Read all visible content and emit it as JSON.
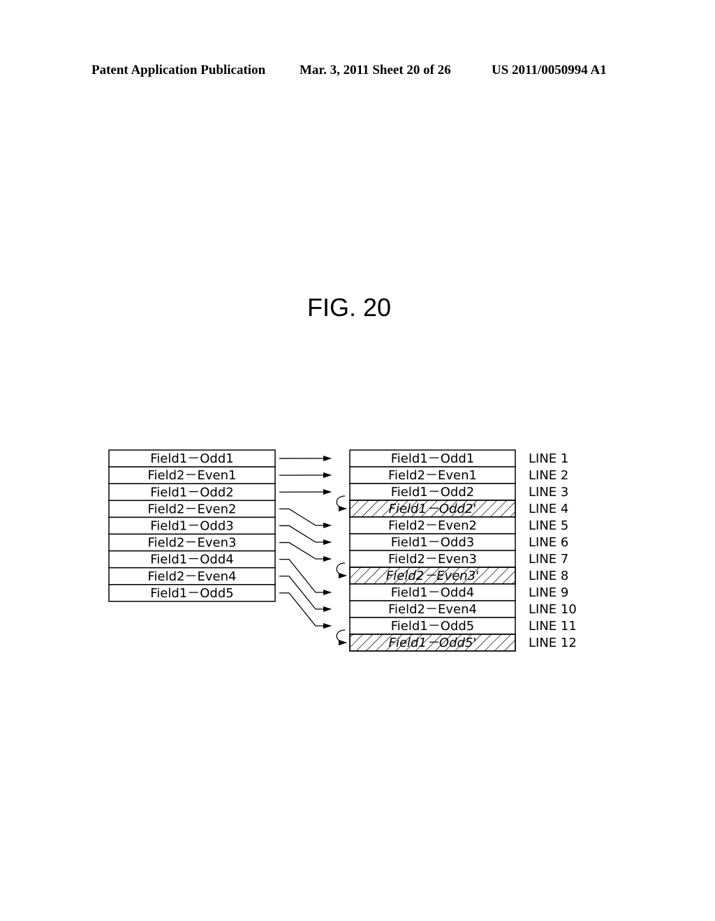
{
  "header": {
    "publication": "Patent Application Publication",
    "date_sheet": "Mar. 3, 2011   Sheet 20 of 26",
    "patent_number": "US 2011/0050994 A1"
  },
  "figure": {
    "title": "FIG. 20",
    "source_fields": [
      "Field1－Odd1",
      "Field2－Even1",
      "Field1－Odd2",
      "Field2－Even2",
      "Field1－Odd3",
      "Field2－Even3",
      "Field1－Odd4",
      "Field2－Even4",
      "Field1－Odd5"
    ],
    "output_lines": [
      {
        "text": "Field1－Odd1",
        "line": "LINE  1",
        "hatched": false
      },
      {
        "text": "Field2－Even1",
        "line": "LINE  2",
        "hatched": false
      },
      {
        "text": "Field1－Odd2",
        "line": "LINE  3",
        "hatched": false
      },
      {
        "text": "Field1－Odd2'",
        "line": "LINE  4",
        "hatched": true
      },
      {
        "text": "Field2－Even2",
        "line": "LINE  5",
        "hatched": false
      },
      {
        "text": "Field1－Odd3",
        "line": "LINE  6",
        "hatched": false
      },
      {
        "text": "Field2－Even3",
        "line": "LINE  7",
        "hatched": false
      },
      {
        "text": "Field2－Even3'",
        "line": "LINE  8",
        "hatched": true
      },
      {
        "text": "Field1－Odd4",
        "line": "LINE  9",
        "hatched": false
      },
      {
        "text": "Field2－Even4",
        "line": "LINE 10",
        "hatched": false
      },
      {
        "text": "Field1－Odd5",
        "line": "LINE 11",
        "hatched": false
      },
      {
        "text": "Field1－Odd5'",
        "line": "LINE 12",
        "hatched": true
      }
    ],
    "mapping": [
      0,
      1,
      2,
      4,
      5,
      6,
      8,
      9,
      10
    ],
    "duplicates": [
      [
        2,
        3
      ],
      [
        6,
        7
      ],
      [
        10,
        11
      ]
    ]
  }
}
